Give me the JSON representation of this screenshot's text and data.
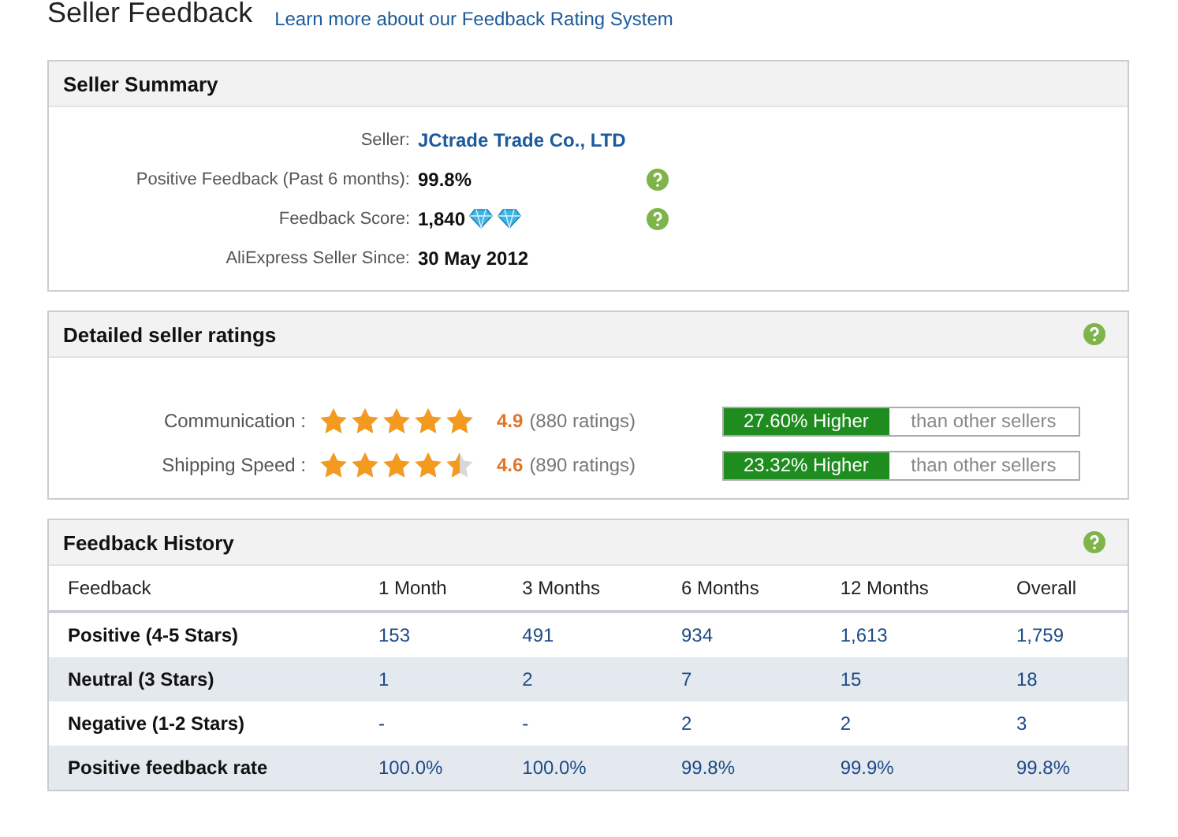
{
  "page_title": "Seller Feedback",
  "learn_more_link": "Learn more about our Feedback Rating System",
  "seller_summary": {
    "title": "Seller Summary",
    "fields": [
      {
        "label": "Seller:",
        "value": "JCtrade Trade Co., LTD",
        "kind": "link",
        "help": false
      },
      {
        "label": "Positive Feedback (Past 6 months):",
        "value": "99.8%",
        "kind": "text",
        "help": true
      },
      {
        "label": "Feedback Score:",
        "value": "1,840",
        "kind": "text",
        "help": true,
        "badges": [
          {
            "kind": "diamond"
          },
          {
            "kind": "diamond"
          }
        ]
      },
      {
        "label": "AliExpress Seller Since:",
        "value": "30 May 2012",
        "kind": "text",
        "help": false
      }
    ]
  },
  "detailed_ratings": {
    "title": "Detailed seller ratings",
    "rows": [
      {
        "label": "Communication :",
        "stars": 5,
        "score": "4.9",
        "count": "(880 ratings)",
        "comparison": "27.60% Higher",
        "suffix": "than other sellers"
      },
      {
        "label": "Shipping Speed :",
        "stars": 4.5,
        "score": "4.6",
        "count": "(890 ratings)",
        "comparison": "23.32% Higher",
        "suffix": "than other sellers"
      }
    ]
  },
  "feedback_history": {
    "title": "Feedback History",
    "columns": [
      "Feedback",
      "1 Month",
      "3 Months",
      "6 Months",
      "12 Months",
      "Overall"
    ],
    "rows": [
      {
        "label": "Positive (4-5 Stars)",
        "values": [
          "153",
          "491",
          "934",
          "1,613",
          "1,759"
        ]
      },
      {
        "label": "Neutral (3 Stars)",
        "values": [
          "1",
          "2",
          "7",
          "15",
          "18"
        ]
      },
      {
        "label": "Negative (1-2 Stars)",
        "values": [
          "-",
          "-",
          "2",
          "2",
          "3"
        ]
      },
      {
        "label": "Positive feedback rate",
        "values": [
          "100.0%",
          "100.0%",
          "99.8%",
          "99.9%",
          "99.8%"
        ]
      }
    ]
  }
}
